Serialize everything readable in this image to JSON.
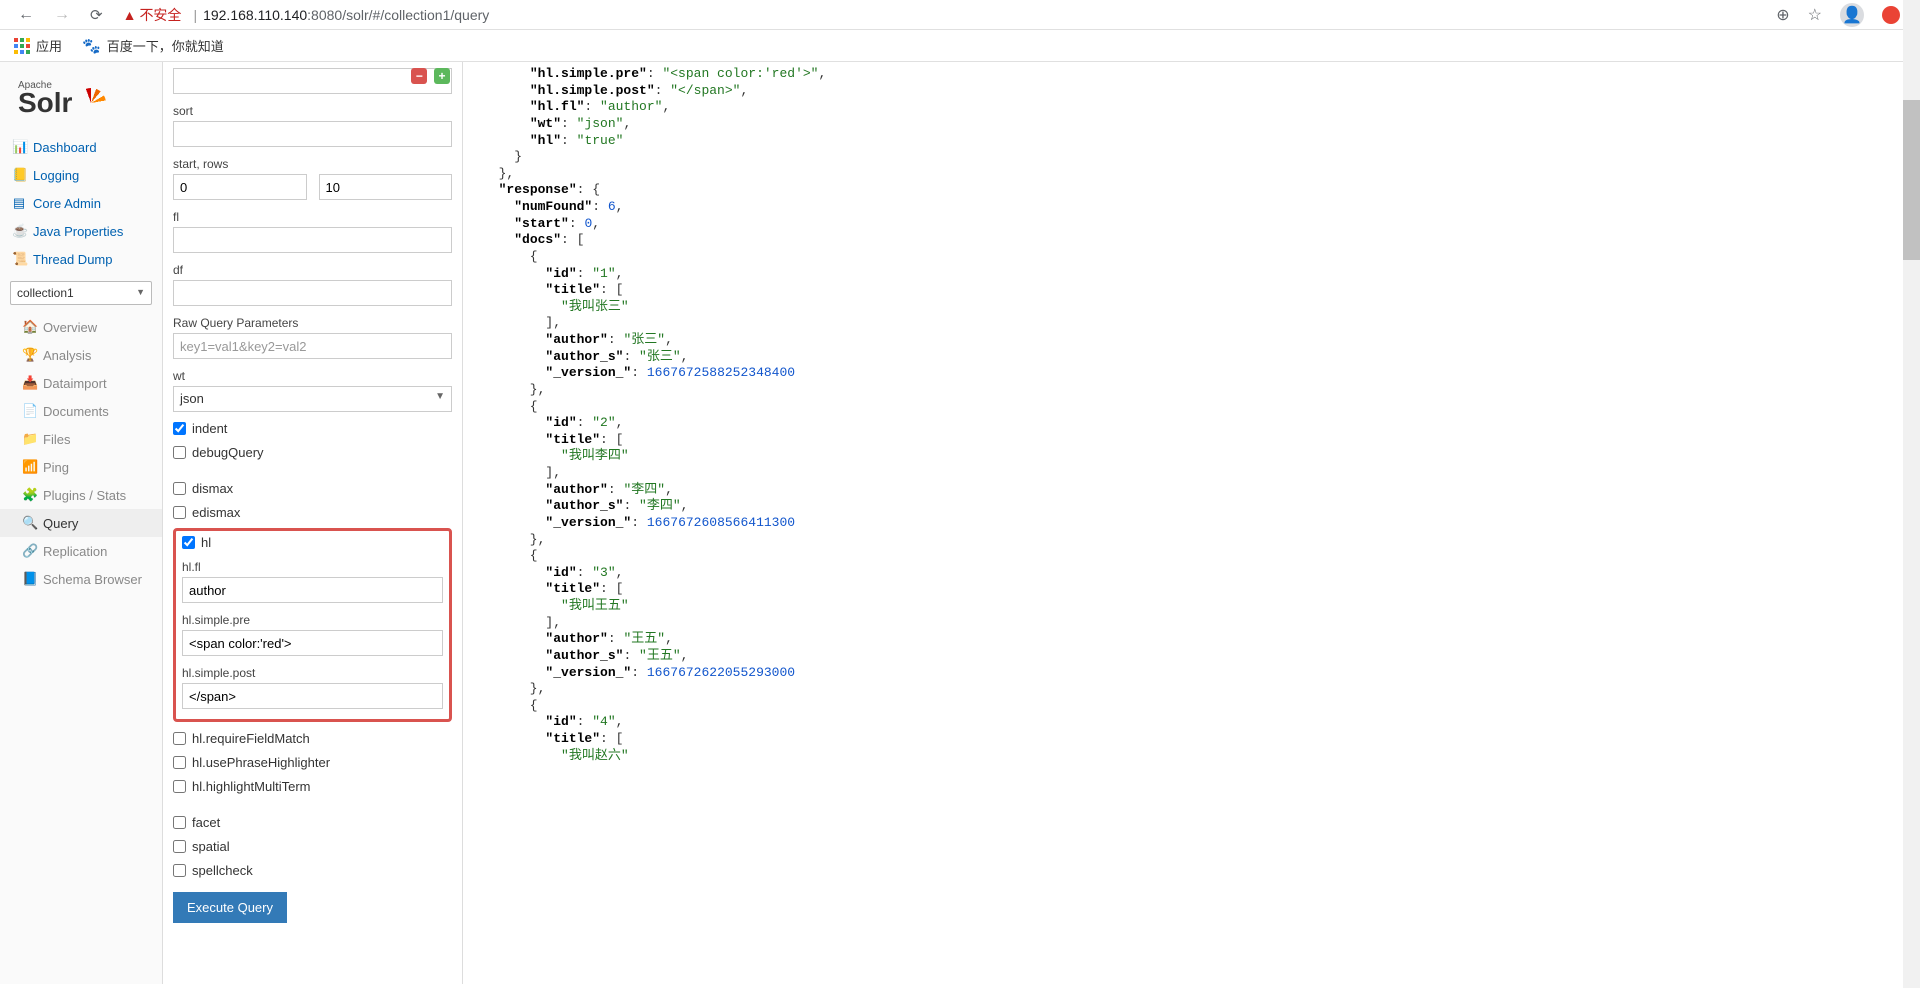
{
  "browser": {
    "insecure_label": "不安全",
    "url_host": "192.168.110.140",
    "url_port": ":8080",
    "url_path": "/solr/#/collection1/query"
  },
  "bookmarks": {
    "apps": "应用",
    "baidu": "百度一下，你就知道"
  },
  "logo": {
    "brand": "Apache",
    "name": "Solr"
  },
  "nav": {
    "dashboard": "Dashboard",
    "logging": "Logging",
    "coreadmin": "Core Admin",
    "javaprops": "Java Properties",
    "threaddump": "Thread Dump"
  },
  "core_selector": "collection1",
  "subnav": {
    "overview": "Overview",
    "analysis": "Analysis",
    "dataimport": "Dataimport",
    "documents": "Documents",
    "files": "Files",
    "ping": "Ping",
    "plugins": "Plugins / Stats",
    "query": "Query",
    "replication": "Replication",
    "schema": "Schema Browser"
  },
  "form": {
    "sort_label": "sort",
    "startrows_label": "start, rows",
    "start": "0",
    "rows": "10",
    "fl_label": "fl",
    "df_label": "df",
    "raw_label": "Raw Query Parameters",
    "raw_placeholder": "key1=val1&key2=val2",
    "wt_label": "wt",
    "wt_value": "json",
    "indent": "indent",
    "debugQuery": "debugQuery",
    "dismax": "dismax",
    "edismax": "edismax",
    "hl": "hl",
    "hlfl_label": "hl.fl",
    "hlfl_value": "author",
    "hlpre_label": "hl.simple.pre",
    "hlpre_value": "<span color:'red'>",
    "hlpost_label": "hl.simple.post",
    "hlpost_value": "</span>",
    "hl_reqfield": "hl.requireFieldMatch",
    "hl_phrase": "hl.usePhraseHighlighter",
    "hl_multi": "hl.highlightMultiTerm",
    "facet": "facet",
    "spatial": "spatial",
    "spellcheck": "spellcheck",
    "exec": "Execute Query"
  },
  "resp": {
    "params_prefix": "      ",
    "hlpre_k": "\"hl.simple.pre\"",
    "hlpre_v": "\"<span color:'red'>\"",
    "hlpost_k": "\"hl.simple.post\"",
    "hlpost_v": "\"</span>\"",
    "hlfl_k": "\"hl.fl\"",
    "hlfl_v": "\"author\"",
    "wt_k": "\"wt\"",
    "wt_v": "\"json\"",
    "hl_k": "\"hl\"",
    "hl_v": "\"true\"",
    "response_k": "\"response\"",
    "numfound_k": "\"numFound\"",
    "numfound_v": "6",
    "start_k": "\"start\"",
    "start_v": "0",
    "docs_k": "\"docs\"",
    "id_k": "\"id\"",
    "title_k": "\"title\"",
    "author_k": "\"author\"",
    "author_s_k": "\"author_s\"",
    "version_k": "\"_version_\"",
    "d1_id": "\"1\"",
    "d1_title": "\"我叫张三\"",
    "d1_author": "\"张三\"",
    "d1_authors": "\"张三\"",
    "d1_ver": "1667672588252348400",
    "d2_id": "\"2\"",
    "d2_title": "\"我叫李四\"",
    "d2_author": "\"李四\"",
    "d2_authors": "\"李四\"",
    "d2_ver": "1667672608566411300",
    "d3_id": "\"3\"",
    "d3_title": "\"我叫王五\"",
    "d3_author": "\"王五\"",
    "d3_authors": "\"王五\"",
    "d3_ver": "1667672622055293000",
    "d4_id": "\"4\"",
    "d4_title": "\"我叫赵六\""
  }
}
